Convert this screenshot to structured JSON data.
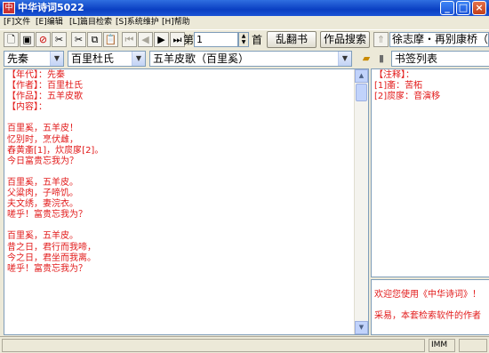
{
  "window": {
    "title": "中华诗词5022"
  },
  "menu": [
    "[F]文件",
    "[E]编辑",
    "[L]篇目检索",
    "[S]系统维护",
    "[H]帮助"
  ],
  "toolbar": {
    "page_prefix": "第",
    "page_value": "1",
    "page_suffix": "首",
    "random_label": "乱翻书",
    "search_label": "作品搜索",
    "info_value": "徐志摩・再别康桥（轻"
  },
  "selectors": {
    "dynasty": "先秦",
    "author": "百里杜氏",
    "work": "五羊皮歌（百里奚）",
    "bookmark": "书签列表"
  },
  "main_text": [
    "【年代】：先秦",
    "【作者】：百里杜氏",
    "【作品】：五羊皮歌",
    "【内容】：",
    "",
    "百里奚，五羊皮！",
    "忆别时，烹伏雌，",
    "舂黄齑[1]，炊扊扅[2]。",
    "今日富贵忘我为？",
    "",
    "百里奚，五羊皮。",
    "父粱肉，子啼饥。",
    "夫文绣，妻浣衣。",
    "嗟乎！富贵忘我为？",
    "",
    "百里奚，五羊皮。",
    "昔之日，君行而我啼，",
    "今之日，君坐而我离。",
    "嗟乎！富贵忘我为？"
  ],
  "notes_text": [
    "【注释】：",
    "[1]齑：苦柘",
    "[2]扊扅：音演移"
  ],
  "welcome_text": [
    "欢迎您使用《中华诗词》！",
    "",
    "采易，本套检索软件的作者"
  ],
  "status": {
    "mode": "IMM"
  },
  "colors": {
    "accent_text": "#e21a1a",
    "titlebar": "#0a3fc2"
  }
}
